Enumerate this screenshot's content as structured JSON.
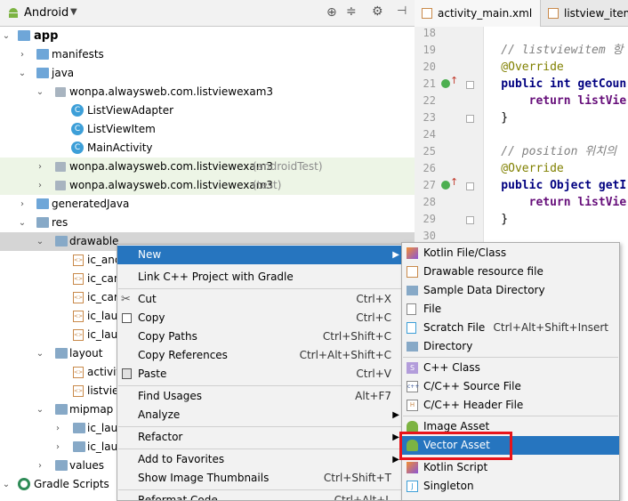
{
  "project_panel": {
    "view_selector": "Android",
    "tree": [
      {
        "label": "app",
        "bold": true
      },
      {
        "label": "manifests"
      },
      {
        "label": "java"
      },
      {
        "label": "wonpa.alwaysweb.com.listviewexam3"
      },
      {
        "label": "ListViewAdapter"
      },
      {
        "label": "ListViewItem"
      },
      {
        "label": "MainActivity"
      },
      {
        "label": "wonpa.alwaysweb.com.listviewexam3",
        "suffix": "(androidTest)"
      },
      {
        "label": "wonpa.alwaysweb.com.listviewexam3",
        "suffix": "(test)"
      },
      {
        "label": "generatedJava"
      },
      {
        "label": "res"
      },
      {
        "label": "drawable"
      },
      {
        "label": "ic_and"
      },
      {
        "label": "ic_can"
      },
      {
        "label": "ic_card"
      },
      {
        "label": "ic_laun"
      },
      {
        "label": "ic_laun"
      },
      {
        "label": "layout"
      },
      {
        "label": "activit"
      },
      {
        "label": "listvie"
      },
      {
        "label": "mipmap"
      },
      {
        "label": "ic_laun"
      },
      {
        "label": "ic_laun"
      },
      {
        "label": "values"
      },
      {
        "label": "Gradle Scripts"
      }
    ]
  },
  "editor": {
    "tabs": [
      "activity_main.xml",
      "listview_item."
    ],
    "lines": [
      {
        "n": "18",
        "code": ""
      },
      {
        "n": "19",
        "code": "    // listviewitem 항"
      },
      {
        "n": "20",
        "code": "    @Override"
      },
      {
        "n": "21",
        "code": "    public int getCoun"
      },
      {
        "n": "22",
        "code": "        return listVie"
      },
      {
        "n": "23",
        "code": "    }"
      },
      {
        "n": "24",
        "code": ""
      },
      {
        "n": "25",
        "code": "    // position 위치의"
      },
      {
        "n": "26",
        "code": "    @Override"
      },
      {
        "n": "27",
        "code": "    public Object getI"
      },
      {
        "n": "28",
        "code": "        return listVie"
      },
      {
        "n": "29",
        "code": "    }"
      },
      {
        "n": "30",
        "code": ""
      }
    ]
  },
  "context_menu": {
    "items": [
      {
        "label": "New",
        "submenu": true,
        "highlighted": true
      },
      {
        "label": "Link C++ Project with Gradle"
      },
      {
        "label": "Cut",
        "shortcut": "Ctrl+X"
      },
      {
        "label": "Copy",
        "shortcut": "Ctrl+C"
      },
      {
        "label": "Copy Paths",
        "shortcut": "Ctrl+Shift+C"
      },
      {
        "label": "Copy References",
        "shortcut": "Ctrl+Alt+Shift+C"
      },
      {
        "label": "Paste",
        "shortcut": "Ctrl+V"
      },
      {
        "label": "Find Usages",
        "shortcut": "Alt+F7"
      },
      {
        "label": "Analyze",
        "submenu": true
      },
      {
        "label": "Refactor",
        "submenu": true
      },
      {
        "label": "Add to Favorites",
        "submenu": true
      },
      {
        "label": "Show Image Thumbnails",
        "shortcut": "Ctrl+Shift+T"
      },
      {
        "label": "Reformat Code",
        "shortcut": "Ctrl+Alt+L"
      }
    ]
  },
  "new_submenu": {
    "items": [
      {
        "label": "Kotlin File/Class"
      },
      {
        "label": "Drawable resource file"
      },
      {
        "label": "Sample Data Directory"
      },
      {
        "label": "File"
      },
      {
        "label": "Scratch File",
        "shortcut": "Ctrl+Alt+Shift+Insert"
      },
      {
        "label": "Directory"
      },
      {
        "label": "C++ Class"
      },
      {
        "label": "C/C++ Source File"
      },
      {
        "label": "C/C++ Header File"
      },
      {
        "label": "Image Asset"
      },
      {
        "label": "Vector Asset",
        "highlighted": true
      },
      {
        "label": "Kotlin Script"
      },
      {
        "label": "Singleton"
      }
    ]
  },
  "colors": {
    "menu_highlight": "#2675bf",
    "annotation_box": "#e8141a",
    "test_package_bg": "#edf5e6"
  }
}
